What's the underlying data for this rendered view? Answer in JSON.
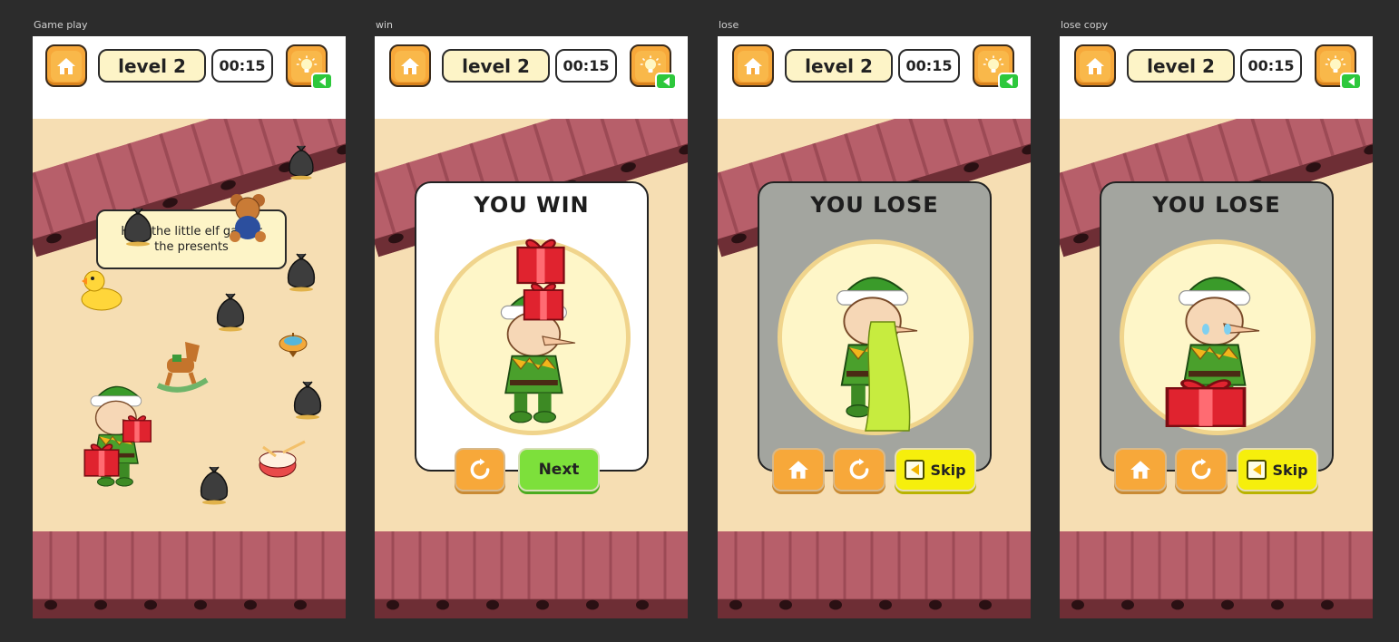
{
  "screens": [
    {
      "label": "Game play",
      "level": "level 2",
      "timer": "00:15",
      "tooltip": "Help the little elf gather the presents"
    },
    {
      "label": "win",
      "level": "level 2",
      "timer": "00:15",
      "title": "YOU WIN",
      "next_label": "Next"
    },
    {
      "label": "lose",
      "level": "level 2",
      "timer": "00:15",
      "title": "YOU LOSE",
      "skip_label": "Skip"
    },
    {
      "label": "lose copy",
      "level": "level 2",
      "timer": "00:15",
      "title": "YOU LOSE",
      "skip_label": "Skip"
    }
  ],
  "icons": {
    "home": "home-icon",
    "hint": "lightbulb-icon",
    "badge": "play-triangle-icon",
    "replay": "replay-icon",
    "skip": "skip-back-icon"
  },
  "colors": {
    "background": "#2c2c2c",
    "button_orange": "#f7a83a",
    "next_green": "#7de03b",
    "skip_yellow": "#f6ef0c",
    "badge_green": "#2dc83c",
    "conveyor": "#b75f6a",
    "floor": "#f6deb3"
  }
}
